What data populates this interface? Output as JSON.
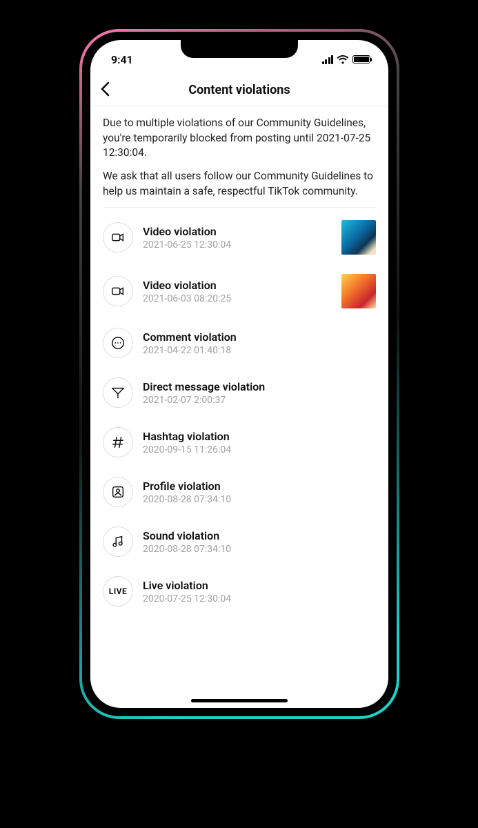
{
  "status_bar": {
    "time": "9:41"
  },
  "nav": {
    "title": "Content violations"
  },
  "notice": {
    "line1": "Due to multiple violations of our Community Guidelines, you're temporarily blocked from posting until 2021-07-25 12:30:04.",
    "line2": "We ask that all users follow our Community Guidelines to help us maintain a safe, respectful TikTok community."
  },
  "violations": [
    {
      "icon": "video",
      "title": "Video violation",
      "timestamp": "2021-06-25 12:30:04",
      "thumb": "ocean"
    },
    {
      "icon": "video",
      "title": "Video violation",
      "timestamp": "2021-06-03 08:20:25",
      "thumb": "warm"
    },
    {
      "icon": "comment",
      "title": "Comment violation",
      "timestamp": "2021-04-22 01:40:18",
      "thumb": null
    },
    {
      "icon": "dm",
      "title": "Direct message violation",
      "timestamp": "2021-02-07 2:00:37",
      "thumb": null
    },
    {
      "icon": "hashtag",
      "title": "Hashtag violation",
      "timestamp": "2020-09-15 11:26:04",
      "thumb": null
    },
    {
      "icon": "profile",
      "title": "Profile violation",
      "timestamp": "2020-08-28 07:34:10",
      "thumb": null
    },
    {
      "icon": "sound",
      "title": "Sound violation",
      "timestamp": "2020-08-28 07:34:10",
      "thumb": null
    },
    {
      "icon": "live",
      "title": "Live violation",
      "timestamp": "2020-07-25 12:30:04",
      "thumb": null
    }
  ],
  "icon_labels": {
    "live": "LIVE"
  }
}
